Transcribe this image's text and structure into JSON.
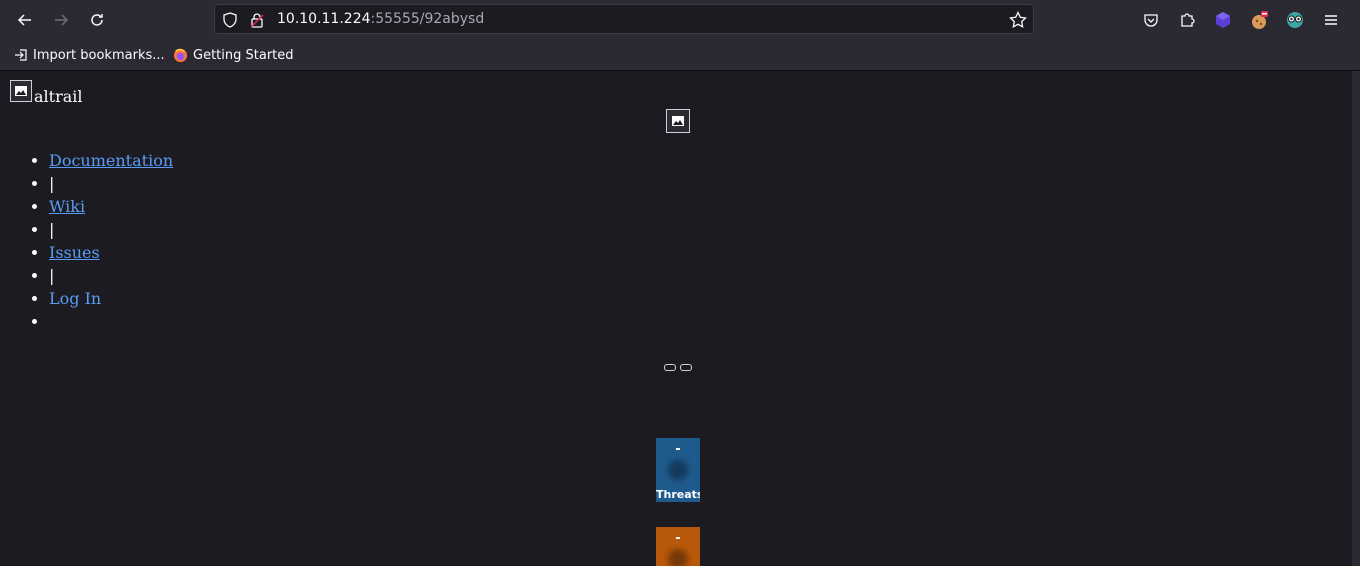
{
  "browser": {
    "url_host": "10.10.11.224",
    "url_path": ":55555/92abysd",
    "bookmarks": [
      {
        "label": "Import bookmarks...",
        "icon": "import-icon"
      },
      {
        "label": "Getting Started",
        "icon": "firefox-icon"
      }
    ]
  },
  "page": {
    "brand_text": "altrail",
    "menu": [
      {
        "label": "Documentation",
        "type": "link"
      },
      {
        "label": "|",
        "type": "separator"
      },
      {
        "label": "Wiki",
        "type": "link"
      },
      {
        "label": "|",
        "type": "separator"
      },
      {
        "label": "Issues",
        "type": "link"
      },
      {
        "label": "|",
        "type": "separator"
      },
      {
        "label": "Log In",
        "type": "link-plain"
      },
      {
        "label": "",
        "type": "empty"
      }
    ],
    "tiles": [
      {
        "value": "-",
        "label": "Threats",
        "color": "#1f5a8c"
      },
      {
        "value": "-",
        "label": "",
        "color": "#b8580a"
      }
    ]
  },
  "colors": {
    "link": "#5a9cf5",
    "chrome": "#2b2a33",
    "page_bg": "#1c1b22"
  }
}
